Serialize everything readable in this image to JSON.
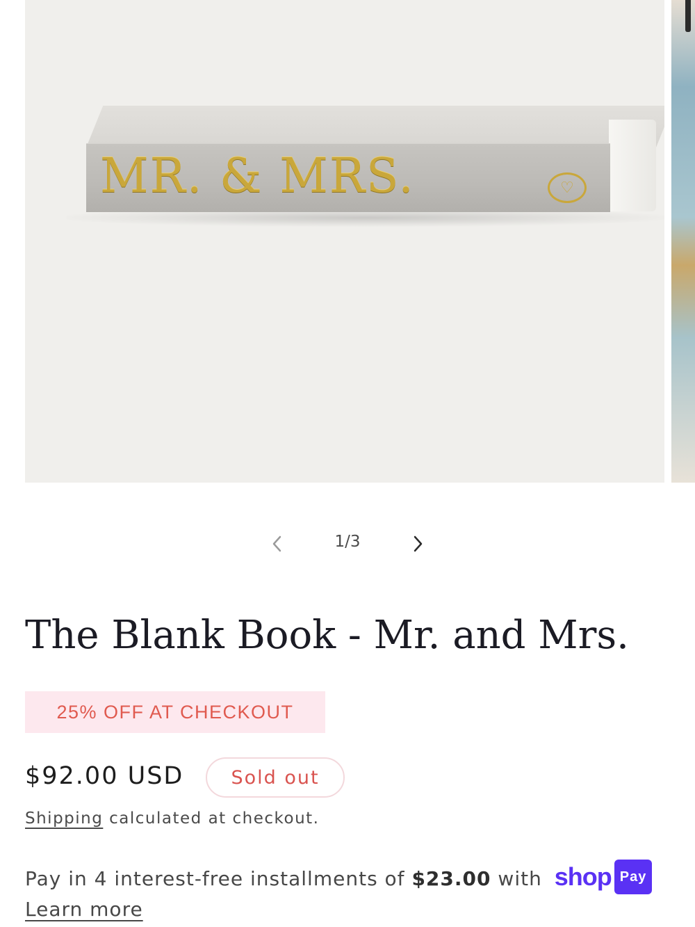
{
  "gallery": {
    "book_spine_text": "MR. & MRS.",
    "book_logo_glyph": "♡",
    "prev_icon": "chevron-left-icon",
    "next_icon": "chevron-right-icon",
    "counter": "1/3"
  },
  "product": {
    "title": "The Blank Book - Mr. and Mrs.",
    "promo": "25% OFF AT CHECKOUT",
    "price": "$92.00 USD",
    "badge": "Sold out",
    "shipping_link": "Shipping",
    "shipping_rest": " calculated at checkout."
  },
  "installments": {
    "text_before": "Pay in 4 interest-free installments of ",
    "amount": "$23.00",
    "text_after": " with ",
    "shop_logo": "shop",
    "pay_badge": "Pay",
    "learn_more": "Learn more"
  },
  "colors": {
    "accent_purple": "#5a31f4",
    "promo_bg": "#fde8ee",
    "promo_text": "#e05a4f",
    "sold_out_text": "#d9534f",
    "gold_foil": "#c9a73b"
  }
}
